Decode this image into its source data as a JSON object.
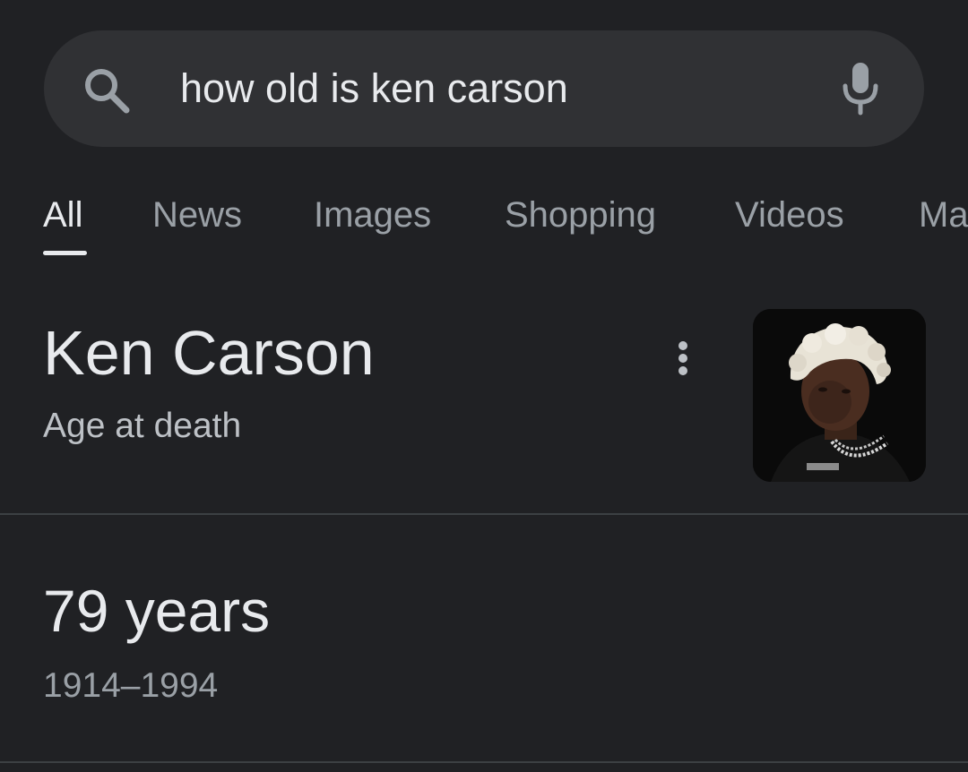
{
  "search": {
    "query": "how old is ken carson",
    "icon": "search-icon",
    "voice_icon": "microphone-icon"
  },
  "tabs": [
    {
      "label": "All",
      "active": true
    },
    {
      "label": "News",
      "active": false
    },
    {
      "label": "Images",
      "active": false
    },
    {
      "label": "Shopping",
      "active": false
    },
    {
      "label": "Videos",
      "active": false
    },
    {
      "label": "Ma",
      "active": false
    }
  ],
  "knowledge_panel": {
    "title": "Ken Carson",
    "subtitle": "Age at death",
    "more_icon": "more-vertical-icon",
    "thumbnail": "person-photo"
  },
  "answer": {
    "value": "79 years",
    "range": "1914–1994"
  },
  "colors": {
    "background": "#202124",
    "search_bar": "#303134",
    "primary_text": "#e8eaed",
    "secondary_text": "#9aa0a6",
    "divider": "#3c4043"
  }
}
